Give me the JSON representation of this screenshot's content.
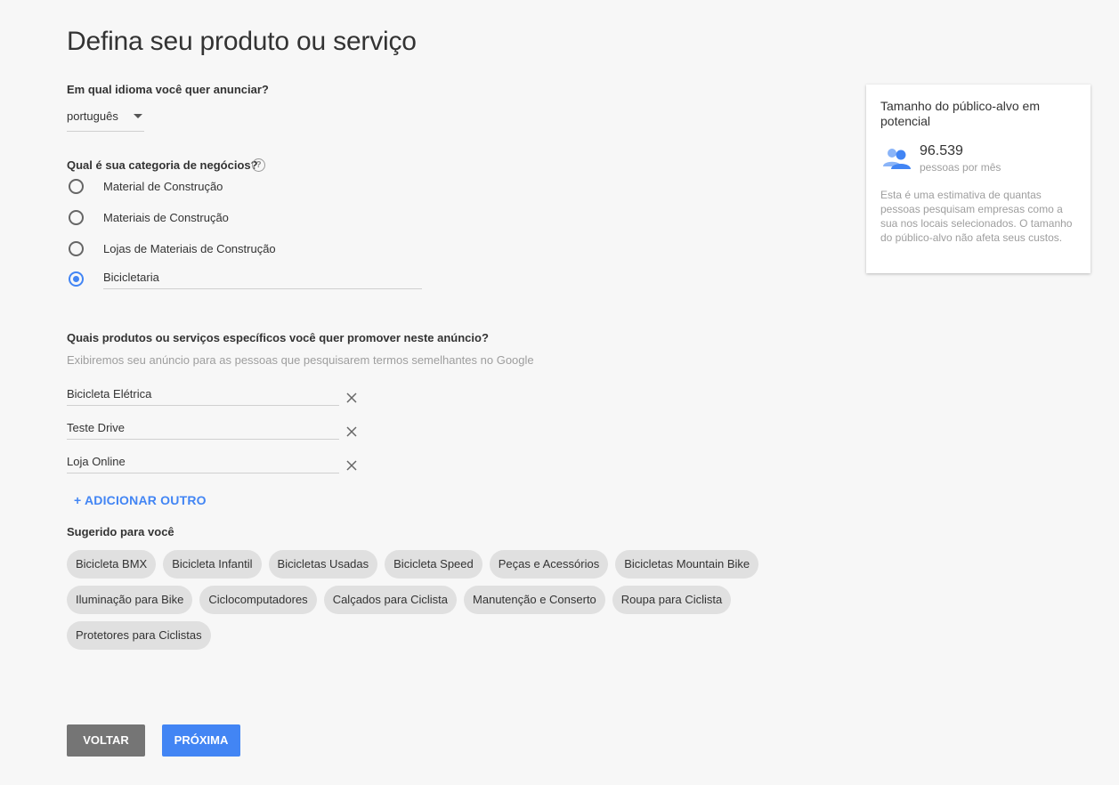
{
  "page": {
    "title": "Defina seu produto ou serviço"
  },
  "language": {
    "question": "Em qual idioma você quer anunciar?",
    "selected": "português"
  },
  "category": {
    "question": "Qual é sua categoria de negócios?",
    "help_icon": "help-circle-icon",
    "options": [
      {
        "label": "Material de Construção",
        "checked": false
      },
      {
        "label": "Materiais de Construção",
        "checked": false
      },
      {
        "label": "Lojas de Materiais de Construção",
        "checked": false
      },
      {
        "label": "Bicicletaria",
        "checked": true
      }
    ]
  },
  "products": {
    "question": "Quais produtos ou serviços específicos você quer promover neste anúncio?",
    "hint": "Exibiremos seu anúncio para as pessoas que pesquisarem termos semelhantes no Google",
    "items": [
      "Bicicleta Elétrica",
      "Teste Drive",
      "Loja Online"
    ],
    "add_label": "+ ADICIONAR OUTRO"
  },
  "suggestions": {
    "title": "Sugerido para você",
    "rows": [
      [
        "Bicicleta BMX",
        "Bicicleta Infantil",
        "Bicicletas Usadas",
        "Bicicleta Speed",
        "Peças e Acessórios",
        "Bicicletas Mountain Bike"
      ],
      [
        "Iluminação para Bike",
        "Ciclocomputadores",
        "Calçados para Ciclista",
        "Manutenção e Conserto",
        "Roupa para Ciclista"
      ],
      [
        "Protetores para Ciclistas"
      ]
    ]
  },
  "buttons": {
    "back": "VOLTAR",
    "next": "PRÓXIMA"
  },
  "audience": {
    "title": "Tamanho do público-alvo em potencial",
    "icon": "people-icon",
    "value": "96.539",
    "unit": "pessoas por mês",
    "note": "Esta é uma estimativa de quantas pessoas pesquisam empresas como a sua nos locais selecionados. O tamanho do público-alvo não afeta seus custos."
  },
  "colors": {
    "accent": "#4285f4",
    "back_button": "#757575",
    "chip": "#e0e0e0"
  }
}
